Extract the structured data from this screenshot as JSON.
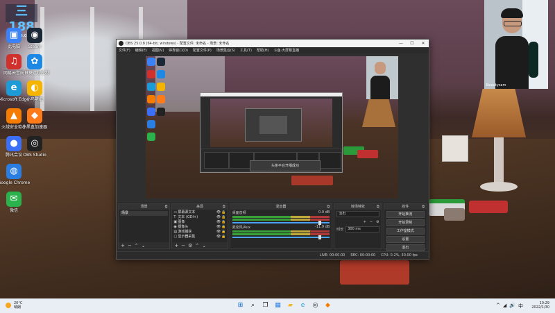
{
  "desktop": {
    "logo_text": "三188",
    "logo_sub": "CQ188.COM",
    "icons": [
      {
        "label": "此电脑",
        "name": "this-pc-icon",
        "color": "#3b82f6",
        "glyph": "▣"
      },
      {
        "label": "Steam",
        "name": "steam-icon",
        "color": "#1b2838",
        "glyph": "◉"
      },
      {
        "label": "网易云音乐",
        "name": "netease-music-icon",
        "color": "#d0312d",
        "glyph": "♫"
      },
      {
        "label": "向日葵远程控制",
        "name": "sunlogin-icon",
        "color": "#1e88e5",
        "glyph": "✿"
      },
      {
        "label": "Microsoft Edge",
        "name": "edge-icon",
        "color": "#1d9bd6",
        "glyph": "e"
      },
      {
        "label": "小鸟壁纸",
        "name": "bird-wallpaper-icon",
        "color": "#f4b400",
        "glyph": "◐"
      },
      {
        "label": "火绒安全软件",
        "name": "huorong-icon",
        "color": "#f57c00",
        "glyph": "▲"
      },
      {
        "label": "小黑盒加速器",
        "name": "xiaoheihe-icon",
        "color": "#ff7b1a",
        "glyph": "◆"
      },
      {
        "label": "腾讯会议",
        "name": "tencent-meeting-icon",
        "color": "#3b6ff5",
        "glyph": "●"
      },
      {
        "label": "OBS Studio",
        "name": "obs-icon",
        "color": "#222222",
        "glyph": "◎"
      },
      {
        "label": "Google Chrome",
        "name": "chrome-icon",
        "color": "#2a7de1",
        "glyph": "◍"
      },
      {
        "label": "微信",
        "name": "wechat-icon",
        "color": "#2bb24c",
        "glyph": "✉"
      }
    ]
  },
  "webcam": {
    "caption": "Beautycam"
  },
  "obs": {
    "title": "OBS 25.0.8 (64-bit, windows) - 配置文件: 未命名 - 场景: 未命名",
    "menu": [
      "文件(F)",
      "编辑(E)",
      "视图(V)",
      "停靠窗口(D)",
      "配置文件(P)",
      "场景集合(S)",
      "工具(T)",
      "帮助(H)",
      "斗鱼·大屏幕直播"
    ],
    "toast": "头条平台开播成功",
    "docks": {
      "scenes": {
        "title": "场景",
        "items": [
          "场景"
        ]
      },
      "sources": {
        "title": "来源",
        "items": [
          {
            "icon": "▭",
            "name": "屏幕源文本"
          },
          {
            "icon": "T",
            "name": "文本 (GDI+)"
          },
          {
            "icon": "▣",
            "name": "图像"
          },
          {
            "icon": "◉",
            "name": "摄像头"
          },
          {
            "icon": "▤",
            "name": "游戏捕获"
          },
          {
            "icon": "▢",
            "name": "显示器采集"
          }
        ]
      },
      "mixer": {
        "title": "混音器",
        "channels": [
          {
            "name": "桌面音频",
            "db": "0.0 dB"
          },
          {
            "name": "麦克风/Aux",
            "db": "-11.9 dB"
          }
        ]
      },
      "transitions": {
        "title": "转场特效",
        "type": "淡出",
        "duration_label": "时长",
        "duration": "300 ms"
      },
      "controls": {
        "title": "控件",
        "buttons": [
          "开始推流",
          "开始录制",
          "工作室模式",
          "设置",
          "退出"
        ]
      }
    },
    "status": {
      "live": "LIVE: 00:00:00",
      "rec": "REC: 00:00:00",
      "cpu": "CPU: 0.2%, 30.00 fps"
    }
  },
  "taskbar": {
    "weather_temp": "20°C",
    "weather_desc": "晴朗",
    "apps": [
      {
        "name": "start-icon",
        "glyph": "⊞",
        "color": "#0a64c8"
      },
      {
        "name": "search-icon",
        "glyph": "⌕",
        "color": "#222222"
      },
      {
        "name": "task-view-icon",
        "glyph": "❐",
        "color": "#222222"
      },
      {
        "name": "widgets-icon",
        "glyph": "▦",
        "color": "#2a7de1"
      },
      {
        "name": "file-explorer-icon",
        "glyph": "▰",
        "color": "#f2b82c"
      },
      {
        "name": "edge-taskbar-icon",
        "glyph": "e",
        "color": "#1d9bd6"
      },
      {
        "name": "obs-taskbar-icon",
        "glyph": "◎",
        "color": "#222222"
      },
      {
        "name": "app-taskbar-icon",
        "glyph": "◆",
        "color": "#f57c00"
      }
    ],
    "tray": [
      "^",
      "◢",
      "🔊",
      "中"
    ],
    "time": "10:29",
    "date": "2022/1/30"
  }
}
